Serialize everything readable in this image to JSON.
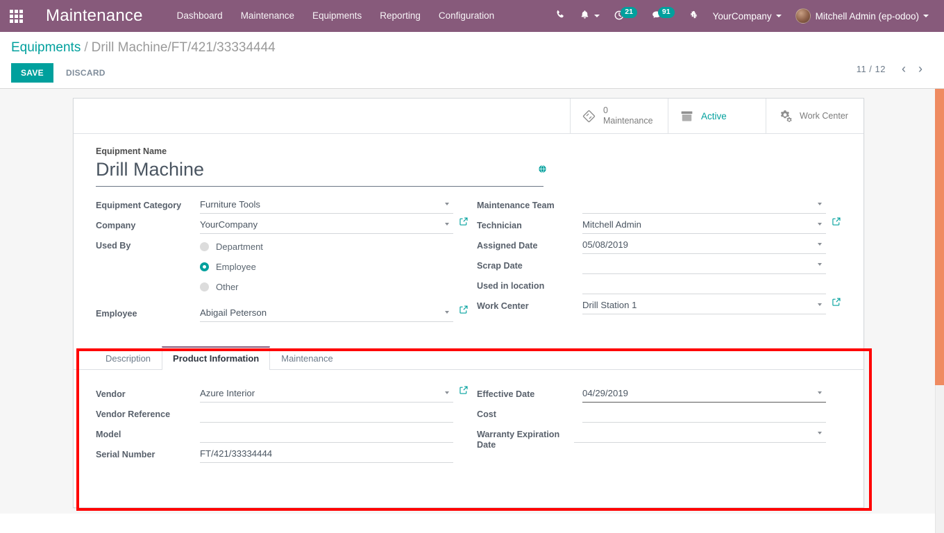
{
  "navbar": {
    "apps_icon": "grid-apps-icon",
    "brand": "Maintenance",
    "menu": [
      {
        "label": "Dashboard"
      },
      {
        "label": "Maintenance"
      },
      {
        "label": "Equipments"
      },
      {
        "label": "Reporting"
      },
      {
        "label": "Configuration"
      }
    ],
    "right": {
      "phone_icon": "phone-icon",
      "bell_icon": "bell-icon",
      "activity_icon": "clock-activity-icon",
      "activity_count": "21",
      "messages_icon": "chat-bubble-icon",
      "messages_count": "91",
      "debug_icon": "bug-icon",
      "company": "YourCompany",
      "user": "Mitchell Admin (ep-odoo)"
    }
  },
  "control_panel": {
    "breadcrumb_root": "Equipments",
    "breadcrumb_sep": "/",
    "breadcrumb_current": "Drill Machine/FT/421/33334444",
    "save_label": "SAVE",
    "discard_label": "DISCARD",
    "pager": {
      "count": "11 / 12",
      "prev_icon": "chevron-left-icon",
      "next_icon": "chevron-right-icon"
    }
  },
  "stat_buttons": [
    {
      "icon": "wrench-tag-icon",
      "value": "0",
      "label": "Maintenance"
    },
    {
      "icon": "archive-box-icon",
      "value": "",
      "label": "Active"
    },
    {
      "icon": "gears-icon",
      "value": "",
      "label": "Work Center"
    }
  ],
  "form": {
    "title_label": "Equipment Name",
    "title_value": "Drill Machine",
    "title_placeholder": "e.g. Drill Machine",
    "translate_icon": "globe-translate-icon",
    "left_fields": [
      {
        "label": "Equipment Category",
        "value": "Furniture Tools",
        "dropdown": true,
        "external": false
      },
      {
        "label": "Company",
        "value": "YourCompany",
        "dropdown": true,
        "external": true
      }
    ],
    "used_by": {
      "label": "Used By",
      "options": [
        {
          "label": "Department",
          "selected": false
        },
        {
          "label": "Employee",
          "selected": true
        },
        {
          "label": "Other",
          "selected": false
        }
      ]
    },
    "employee_field": {
      "label": "Employee",
      "value": "Abigail Peterson",
      "dropdown": true,
      "external": true
    },
    "right_fields": [
      {
        "label": "Maintenance Team",
        "value": "",
        "dropdown": true,
        "external": false
      },
      {
        "label": "Technician",
        "value": "Mitchell Admin",
        "dropdown": true,
        "external": true
      },
      {
        "label": "Assigned Date",
        "value": "05/08/2019",
        "dropdown": true,
        "external": false
      },
      {
        "label": "Scrap Date",
        "value": "",
        "dropdown": true,
        "external": false
      },
      {
        "label": "Used in location",
        "value": "",
        "dropdown": false,
        "external": false
      },
      {
        "label": "Work Center",
        "value": "Drill Station 1",
        "dropdown": true,
        "external": true
      }
    ]
  },
  "notebook": {
    "tabs": [
      {
        "label": "Description",
        "active": false
      },
      {
        "label": "Product Information",
        "active": true
      },
      {
        "label": "Maintenance",
        "active": false
      }
    ],
    "product_information": {
      "left_fields": [
        {
          "label": "Vendor",
          "value": "Azure Interior",
          "dropdown": true,
          "external": true
        },
        {
          "label": "Vendor Reference",
          "value": "",
          "dropdown": false,
          "external": false
        },
        {
          "label": "Model",
          "value": "",
          "dropdown": false,
          "external": false
        },
        {
          "label": "Serial Number",
          "value": "FT/421/33334444",
          "dropdown": false,
          "external": false
        }
      ],
      "right_fields": [
        {
          "label": "Effective Date",
          "value": "04/29/2019",
          "dropdown": true,
          "external": false,
          "focused": true
        },
        {
          "label": "Cost",
          "value": "",
          "dropdown": false,
          "external": false,
          "focused": false
        },
        {
          "label": "Warranty Expiration Date",
          "value": "",
          "dropdown": true,
          "external": false,
          "focused": false
        }
      ]
    }
  },
  "colors": {
    "navbar_purple": "#875a7b",
    "accent_teal": "#00a09d",
    "badge_teal": "#00a09d",
    "highlight_red": "#ff0000",
    "scrollbar_orange": "#ef8b61"
  }
}
